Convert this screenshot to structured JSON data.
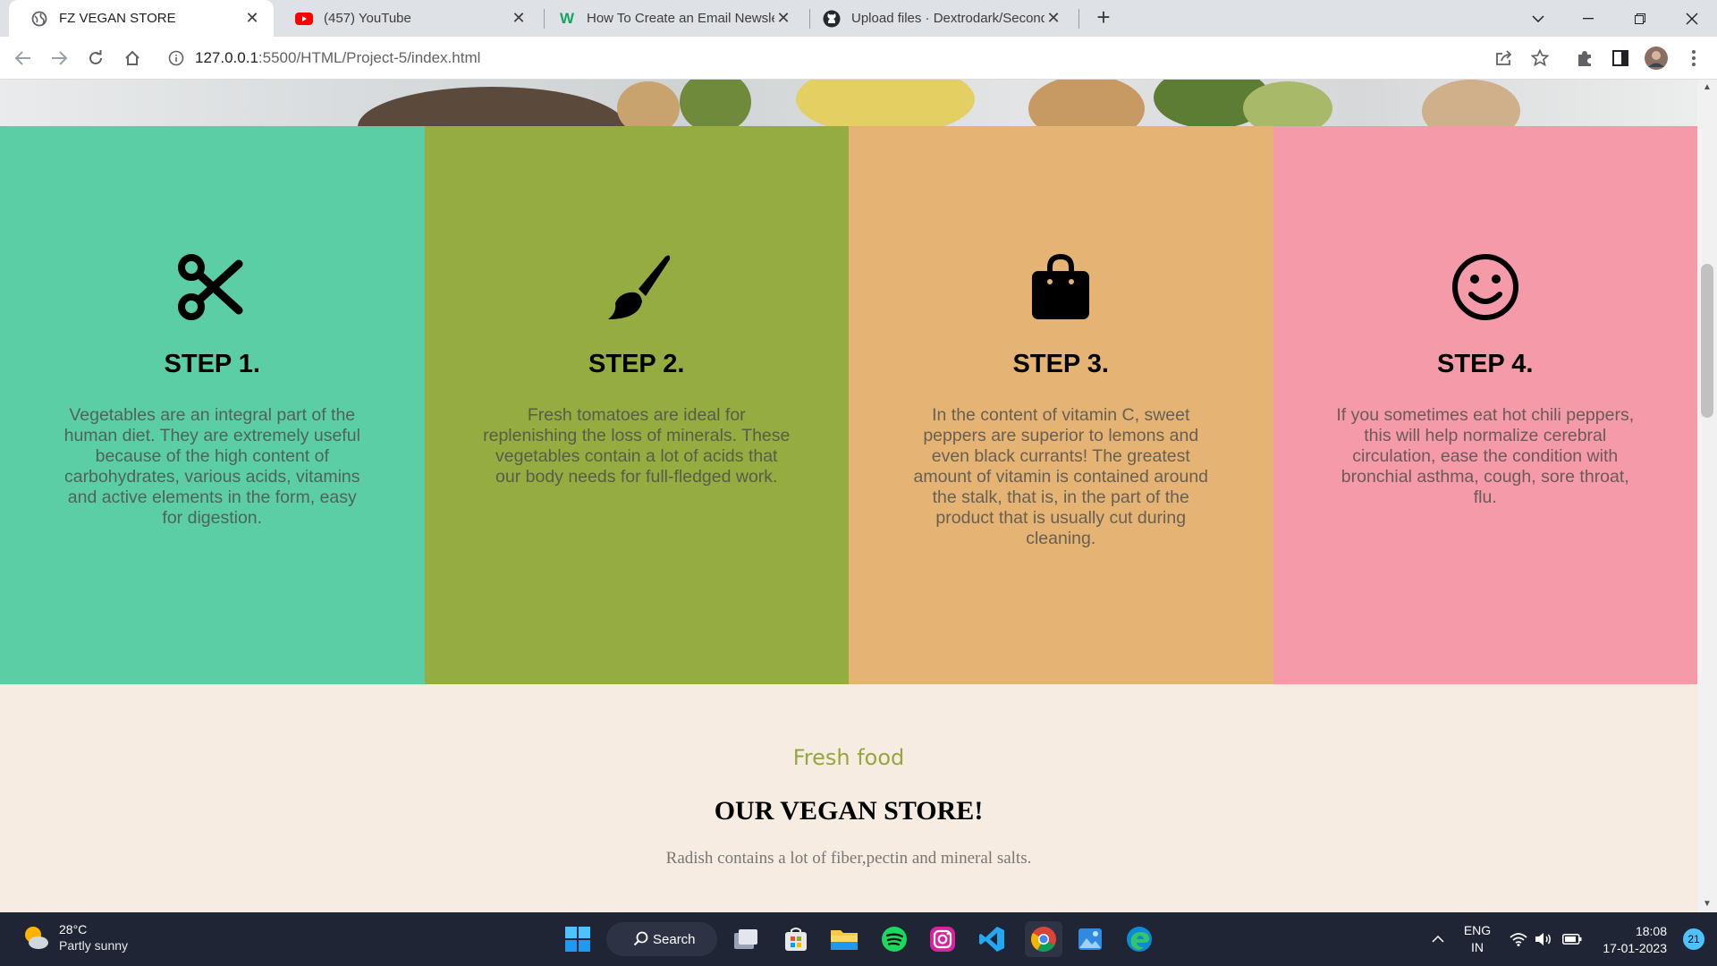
{
  "browser": {
    "tabs": [
      {
        "title": "FZ VEGAN STORE",
        "icon": "globe-icon",
        "active": true
      },
      {
        "title": "(457) YouTube",
        "icon": "youtube-icon",
        "active": false
      },
      {
        "title": "How To Create an Email Newsletter",
        "icon": "w-logo-icon",
        "active": false
      },
      {
        "title": "Upload files · Dextrodark/Second",
        "icon": "github-icon",
        "active": false
      }
    ],
    "url_host": "127.0.0.1",
    "url_path": ":5500/HTML/Project-5/index.html"
  },
  "steps": [
    {
      "title": "STEP 1.",
      "icon": "scissors-icon",
      "color": "#5ccea6",
      "text": "Vegetables are an integral part of the human diet. They are extremely useful because of the high content of carbohydrates, various acids, vitamins and active elements in the form, easy for digestion."
    },
    {
      "title": "STEP 2.",
      "icon": "paintbrush-icon",
      "color": "#95ac41",
      "text": "Fresh tomatoes are ideal for replenishing the loss of minerals. These vegetables contain a lot of acids that our body needs for full-fledged work."
    },
    {
      "title": "STEP 3.",
      "icon": "shopping-bag-icon",
      "color": "#e5b475",
      "text": "In the content of vitamin C, sweet peppers are superior to lemons and even black currants! The greatest amount of vitamin is contained around the stalk, that is, in the part of the product that is usually cut during cleaning."
    },
    {
      "title": "STEP 4.",
      "icon": "smiley-face-icon",
      "color": "#f59aa8",
      "text": "If you sometimes eat hot chili peppers, this will help normalize cerebral circulation, ease the condition with bronchial asthma, cough, sore throat, flu."
    }
  ],
  "store": {
    "subtitle": "Fresh food",
    "title": "OUR VEGAN STORE!",
    "description": "Radish contains a lot of fiber,pectin and mineral salts."
  },
  "taskbar": {
    "weather_temp": "28°C",
    "weather_condition": "Partly sunny",
    "search_label": "Search",
    "lang_primary": "ENG",
    "lang_secondary": "IN",
    "time": "18:08",
    "date": "17-01-2023",
    "notification_count": "21"
  }
}
